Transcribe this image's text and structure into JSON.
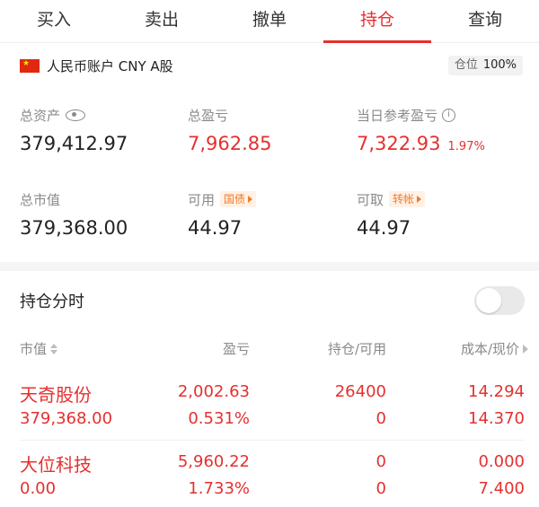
{
  "tabs": [
    {
      "label": "买入"
    },
    {
      "label": "卖出"
    },
    {
      "label": "撤单"
    },
    {
      "label": "持仓"
    },
    {
      "label": "查询"
    }
  ],
  "active_tab": "持仓",
  "account": {
    "label": "人民币账户 CNY A股",
    "position_label": "仓位",
    "position_value": "100%"
  },
  "summary": {
    "total_assets": {
      "label": "总资产",
      "value": "379,412.97"
    },
    "total_pnl": {
      "label": "总盈亏",
      "value": "7,962.85"
    },
    "today_pnl": {
      "label": "当日参考盈亏",
      "value": "7,322.93",
      "pct": "1.97%"
    },
    "market_value": {
      "label": "总市值",
      "value": "379,368.00"
    },
    "available": {
      "label": "可用",
      "value": "44.97",
      "tag": "国债"
    },
    "withdrawable": {
      "label": "可取",
      "value": "44.97",
      "tag": "转帐"
    }
  },
  "timing": {
    "label": "持仓分时",
    "enabled": false
  },
  "table": {
    "headers": {
      "market_value": "市值",
      "pnl": "盈亏",
      "holding": "持仓/可用",
      "cost": "成本/现价"
    },
    "rows": [
      {
        "name": "天奇股份",
        "market_value": "379,368.00",
        "pnl": "2,002.63",
        "pnl_pct": "0.531%",
        "holding": "26400",
        "available": "0",
        "cost": "14.294",
        "price": "14.370"
      },
      {
        "name": "大位科技",
        "market_value": "0.00",
        "pnl": "5,960.22",
        "pnl_pct": "1.733%",
        "holding": "0",
        "available": "0",
        "cost": "0.000",
        "price": "7.400"
      }
    ]
  },
  "colors": {
    "accent": "#e5302f",
    "label_gray": "#8a8a8a",
    "tag_orange": "#f07c2a"
  }
}
